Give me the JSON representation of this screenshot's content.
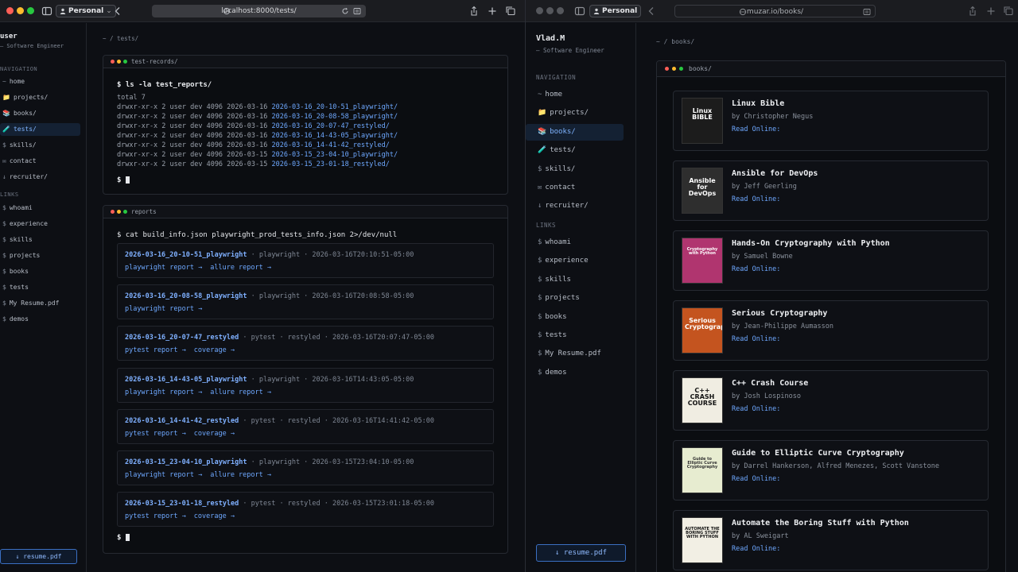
{
  "left": {
    "profile": "Personal",
    "url": "localhost:8000/tests/",
    "user": {
      "name": "user",
      "role": "— Software Engineer"
    },
    "nav_label": "NAVIGATION",
    "nav": [
      {
        "glyph": "~",
        "label": "home"
      },
      {
        "glyph": "📁",
        "label": "projects/"
      },
      {
        "glyph": "📚",
        "label": "books/"
      },
      {
        "glyph": "🧪",
        "label": "tests/"
      },
      {
        "glyph": "$",
        "label": "skills/"
      },
      {
        "glyph": "✉",
        "label": "contact"
      },
      {
        "glyph": "↓",
        "label": "recruiter/"
      }
    ],
    "links_label": "LINKS",
    "links": [
      {
        "glyph": "$",
        "label": "whoami"
      },
      {
        "glyph": "$",
        "label": "experience"
      },
      {
        "glyph": "$",
        "label": "skills"
      },
      {
        "glyph": "$",
        "label": "projects"
      },
      {
        "glyph": "$",
        "label": "books"
      },
      {
        "glyph": "$",
        "label": "tests"
      },
      {
        "glyph": "$",
        "label": "My Resume.pdf"
      },
      {
        "glyph": "$",
        "label": "demos"
      }
    ],
    "resume_button": "↓ resume.pdf",
    "breadcrumb": "~ / tests/",
    "records_panel": {
      "title": "test-records/",
      "command": "$ ls -la test_reports/",
      "total": "total 7",
      "rows": [
        {
          "meta": "drwxr-xr-x 2 user dev 4096 2026-03-16 ",
          "name": "2026-03-16_20-10-51_playwright/"
        },
        {
          "meta": "drwxr-xr-x 2 user dev 4096 2026-03-16 ",
          "name": "2026-03-16_20-08-58_playwright/"
        },
        {
          "meta": "drwxr-xr-x 2 user dev 4096 2026-03-16 ",
          "name": "2026-03-16_20-07-47_restyled/"
        },
        {
          "meta": "drwxr-xr-x 2 user dev 4096 2026-03-16 ",
          "name": "2026-03-16_14-43-05_playwright/"
        },
        {
          "meta": "drwxr-xr-x 2 user dev 4096 2026-03-16 ",
          "name": "2026-03-16_14-41-42_restyled/"
        },
        {
          "meta": "drwxr-xr-x 2 user dev 4096 2026-03-15 ",
          "name": "2026-03-15_23-04-10_playwright/"
        },
        {
          "meta": "drwxr-xr-x 2 user dev 4096 2026-03-15 ",
          "name": "2026-03-15_23-01-18_restyled/"
        }
      ],
      "prompt": "$"
    },
    "reports_panel": {
      "title": "reports",
      "command": "$ cat build_info.json playwright_prod_tests_info.json 2>/dev/null",
      "reports": [
        {
          "name": "2026-03-16_20-10-51_playwright",
          "meta": " · playwright · 2026-03-16T20:10:51-05:00",
          "links": [
            "playwright report →",
            "allure report →"
          ]
        },
        {
          "name": "2026-03-16_20-08-58_playwright",
          "meta": " · playwright · 2026-03-16T20:08:58-05:00",
          "links": [
            "playwright report →"
          ]
        },
        {
          "name": "2026-03-16_20-07-47_restyled",
          "meta": " · pytest · restyled · 2026-03-16T20:07:47-05:00",
          "links": [
            "pytest report →",
            "coverage →"
          ]
        },
        {
          "name": "2026-03-16_14-43-05_playwright",
          "meta": " · playwright · 2026-03-16T14:43:05-05:00",
          "links": [
            "playwright report →",
            "allure report →"
          ]
        },
        {
          "name": "2026-03-16_14-41-42_restyled",
          "meta": " · pytest · restyled · 2026-03-16T14:41:42-05:00",
          "links": [
            "pytest report →",
            "coverage →"
          ]
        },
        {
          "name": "2026-03-15_23-04-10_playwright",
          "meta": " · playwright · 2026-03-15T23:04:10-05:00",
          "links": [
            "playwright report →",
            "allure report →"
          ]
        },
        {
          "name": "2026-03-15_23-01-18_restyled",
          "meta": " · pytest · restyled · 2026-03-15T23:01:18-05:00",
          "links": [
            "pytest report →",
            "coverage →"
          ]
        }
      ],
      "prompt": "$"
    }
  },
  "right": {
    "profile": "Personal",
    "url": "muzar.io/books/",
    "user": {
      "name": "Vlad.M",
      "role": "— Software Engineer"
    },
    "nav_label": "NAVIGATION",
    "nav": [
      {
        "glyph": "~",
        "label": "home"
      },
      {
        "glyph": "📁",
        "label": "projects/"
      },
      {
        "glyph": "📚",
        "label": "books/"
      },
      {
        "glyph": "🧪",
        "label": "tests/"
      },
      {
        "glyph": "$",
        "label": "skills/"
      },
      {
        "glyph": "✉",
        "label": "contact"
      },
      {
        "glyph": "↓",
        "label": "recruiter/"
      }
    ],
    "links_label": "LINKS",
    "links": [
      {
        "glyph": "$",
        "label": "whoami"
      },
      {
        "glyph": "$",
        "label": "experience"
      },
      {
        "glyph": "$",
        "label": "skills"
      },
      {
        "glyph": "$",
        "label": "projects"
      },
      {
        "glyph": "$",
        "label": "books"
      },
      {
        "glyph": "$",
        "label": "tests"
      },
      {
        "glyph": "$",
        "label": "My Resume.pdf"
      },
      {
        "glyph": "$",
        "label": "demos"
      }
    ],
    "resume_button": "↓ resume.pdf",
    "breadcrumb": "~ / books/",
    "books_panel": {
      "title": "books/",
      "read_label": "Read Online:",
      "books": [
        {
          "title": "Linux Bible",
          "author": "by Christopher Negus",
          "cover_text": "Linux BIBLE",
          "cover_bg": "#1c1c1c",
          "cover_fg": "#ffffff"
        },
        {
          "title": "Ansible for DevOps",
          "author": "by Jeff Geerling",
          "cover_text": "Ansible for DevOps",
          "cover_bg": "#2e2e2e",
          "cover_fg": "#ffffff"
        },
        {
          "title": "Hands-On Cryptography with Python",
          "author": "by Samuel Bowne",
          "cover_text": "Cryptography with Python",
          "cover_bg": "#b0356f",
          "cover_fg": "#ffffff"
        },
        {
          "title": "Serious Cryptography",
          "author": "by Jean-Philippe Aumasson",
          "cover_text": "Serious Cryptography",
          "cover_bg": "#c4541f",
          "cover_fg": "#ffffff"
        },
        {
          "title": "C++ Crash Course",
          "author": "by Josh Lospinoso",
          "cover_text": "C++ CRASH COURSE",
          "cover_bg": "#f0ede2",
          "cover_fg": "#111111"
        },
        {
          "title": "Guide to Elliptic Curve Cryptography",
          "author": "by Darrel Hankerson, Alfred Menezes, Scott Vanstone",
          "cover_text": "Guide to Elliptic Curve Cryptography",
          "cover_bg": "#e7ecd0",
          "cover_fg": "#333333"
        },
        {
          "title": "Automate the Boring Stuff with Python",
          "author": "by AL Sweigart",
          "cover_text": "AUTOMATE THE BORING STUFF WITH PYTHON",
          "cover_bg": "#f2efe4",
          "cover_fg": "#111111"
        }
      ]
    }
  }
}
